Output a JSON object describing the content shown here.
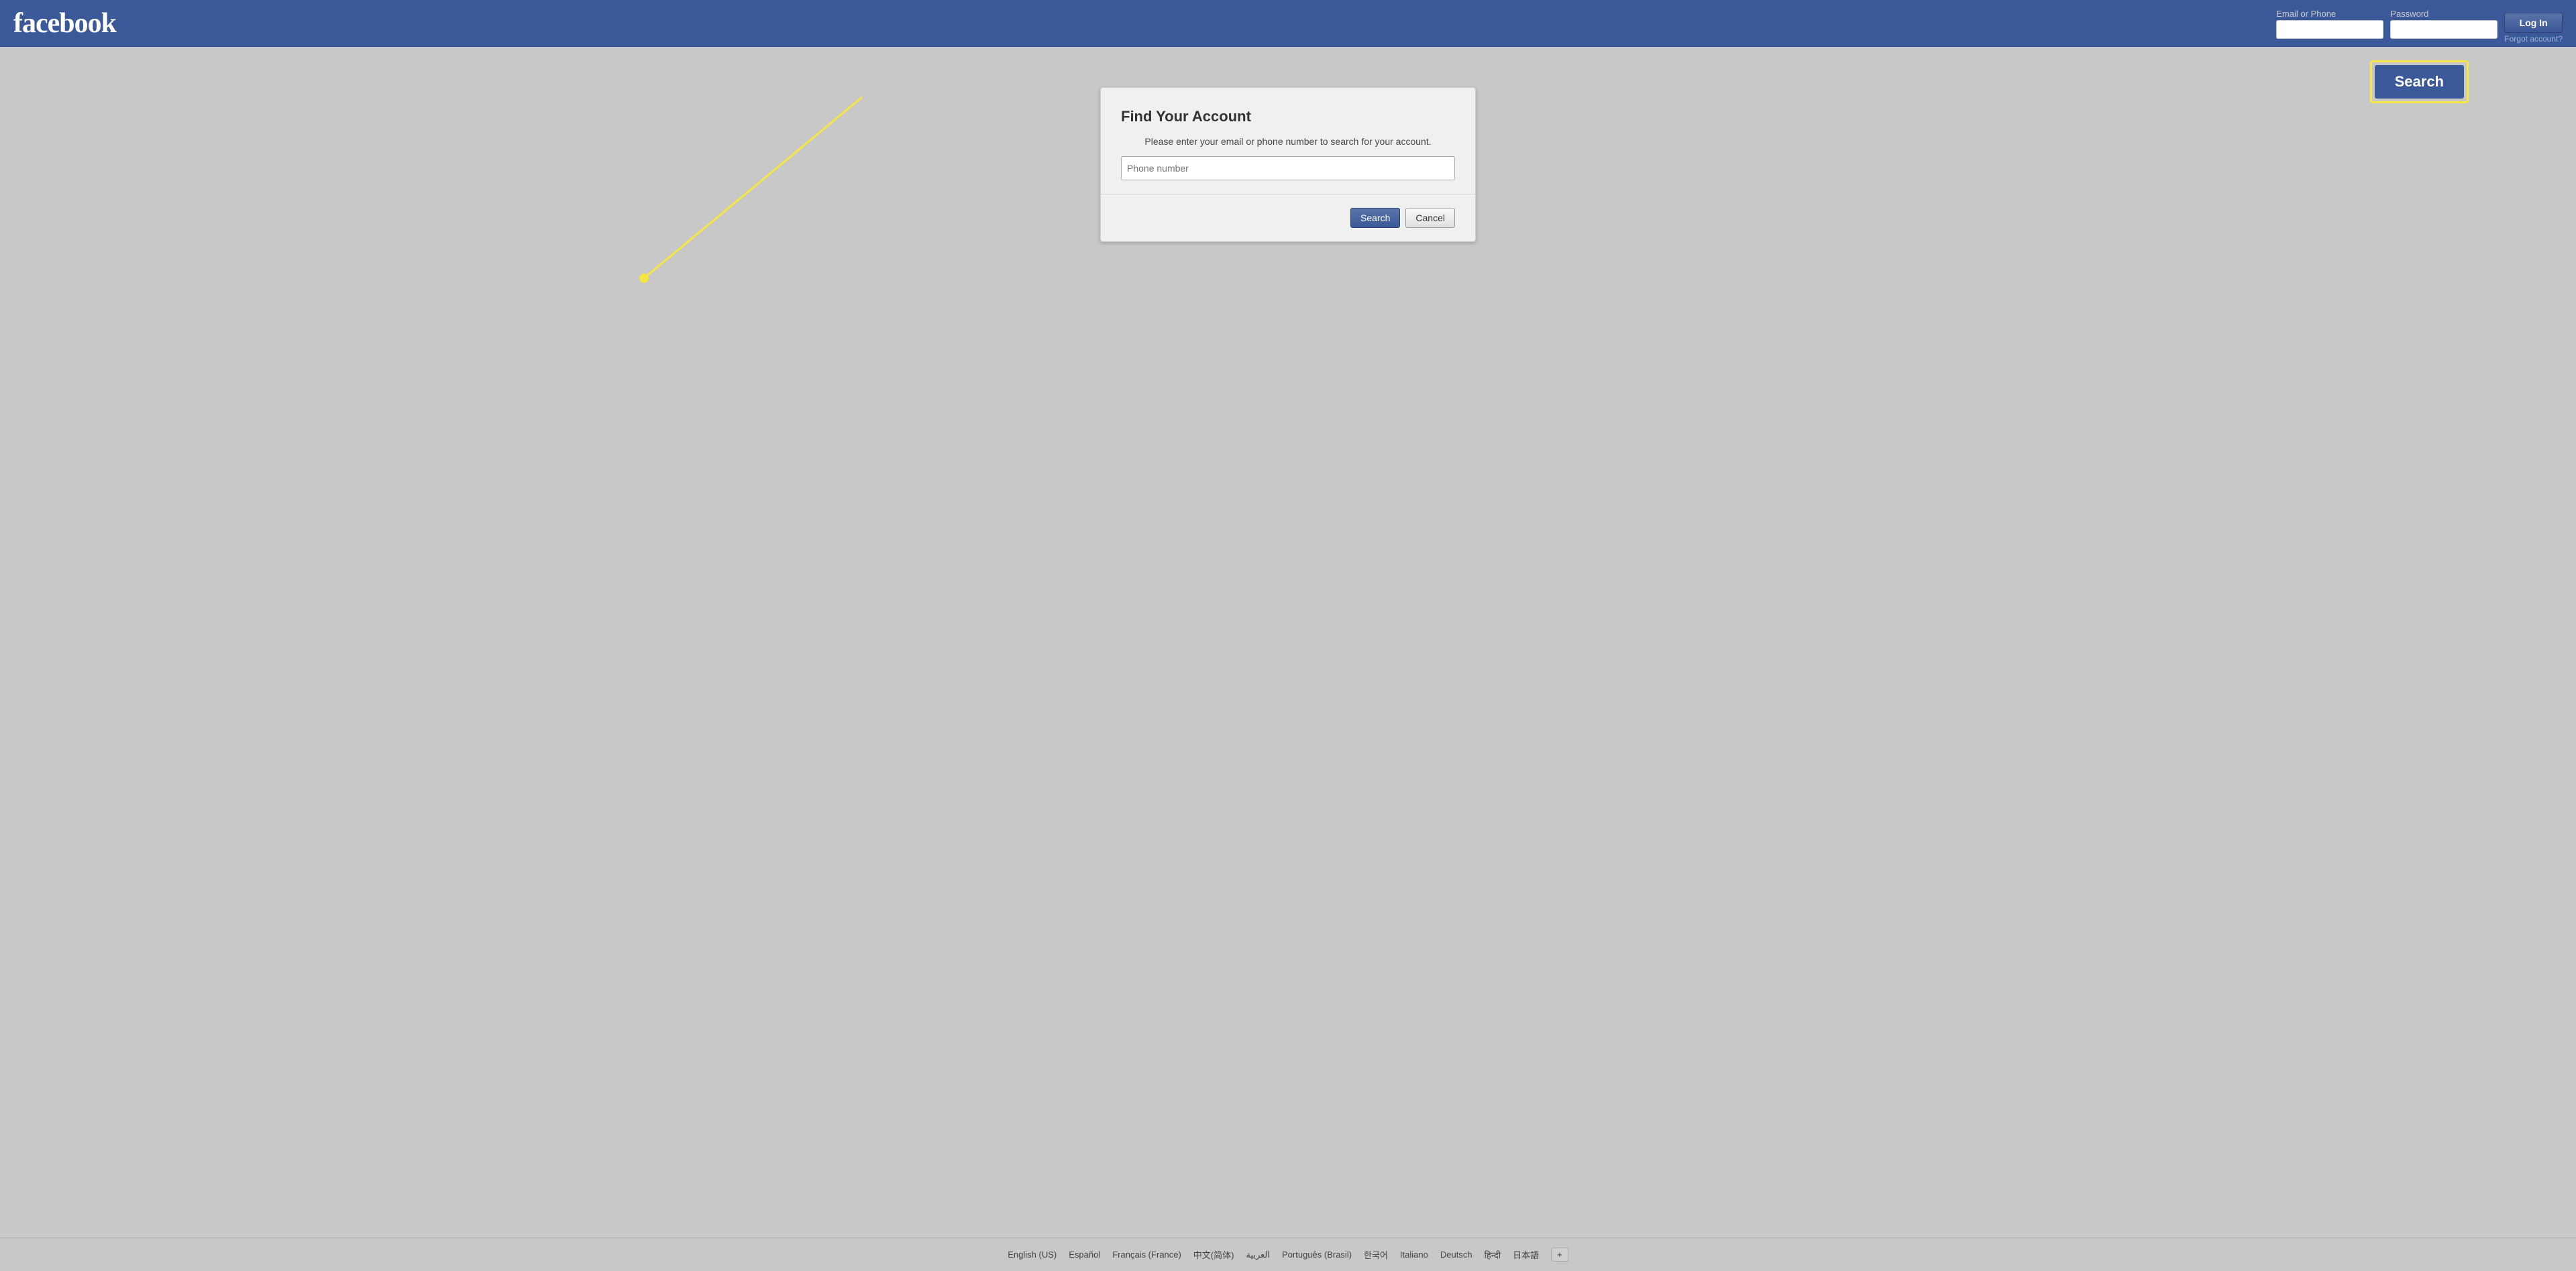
{
  "header": {
    "logo": "facebook",
    "email_label": "Email or Phone",
    "password_label": "Password",
    "email_placeholder": "",
    "password_placeholder": "",
    "login_button": "Log In",
    "forgot_link": "Forgot account?"
  },
  "highlight": {
    "search_button_label": "Search"
  },
  "modal": {
    "title": "Find Your Account",
    "description": "Please enter your email or phone number to search for your account.",
    "phone_placeholder": "Phone number",
    "search_button": "Search",
    "cancel_button": "Cancel"
  },
  "footer": {
    "links": [
      "English (US)",
      "Español",
      "Français (France)",
      "中文(简体)",
      "العربية",
      "Português (Brasil)",
      "한국어",
      "Italiano",
      "Deutsch",
      "हिन्दी",
      "日本語"
    ],
    "add_language": "+"
  }
}
